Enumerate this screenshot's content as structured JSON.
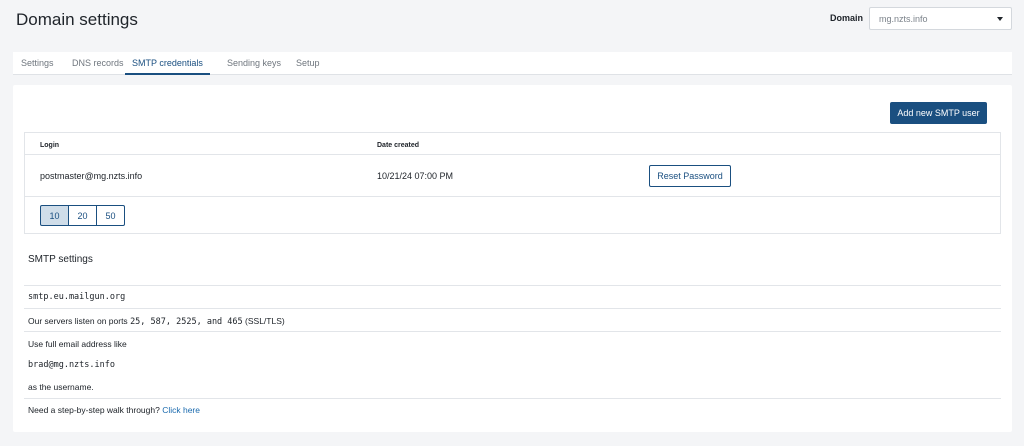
{
  "header": {
    "title": "Domain settings",
    "domain_label": "Domain",
    "domain_value": "mg.nzts.info"
  },
  "tabs": [
    {
      "label": "Settings",
      "active": false
    },
    {
      "label": "DNS records",
      "active": false
    },
    {
      "label": "SMTP credentials",
      "active": true
    },
    {
      "label": "Sending keys",
      "active": false
    },
    {
      "label": "Setup",
      "active": false
    }
  ],
  "credentials": {
    "add_button": "Add new SMTP user",
    "columns": [
      "Login",
      "Date created"
    ],
    "rows": [
      {
        "login": "postmaster@mg.nzts.info",
        "date_created": "10/21/24 07:00 PM",
        "action": "Reset Password"
      }
    ],
    "page_sizes": [
      "10",
      "20",
      "50"
    ],
    "selected_page_size": "10"
  },
  "smtp_settings": {
    "title": "SMTP settings",
    "host": "smtp.eu.mailgun.org",
    "ports_prefix": "Our servers listen on ports",
    "ports": "25, 587, 2525, and 465",
    "ports_suffix": "(SSL/TLS)",
    "username_intro": "Use full email address like",
    "username_example": "brad@mg.nzts.info",
    "username_outro": "as the username.",
    "walkthrough_text": "Need a step-by-step walk through?",
    "walkthrough_link": "Click here"
  },
  "colors": {
    "accent": "#1a4f80",
    "link": "#1a6aae",
    "background": "#f4f5f7"
  }
}
